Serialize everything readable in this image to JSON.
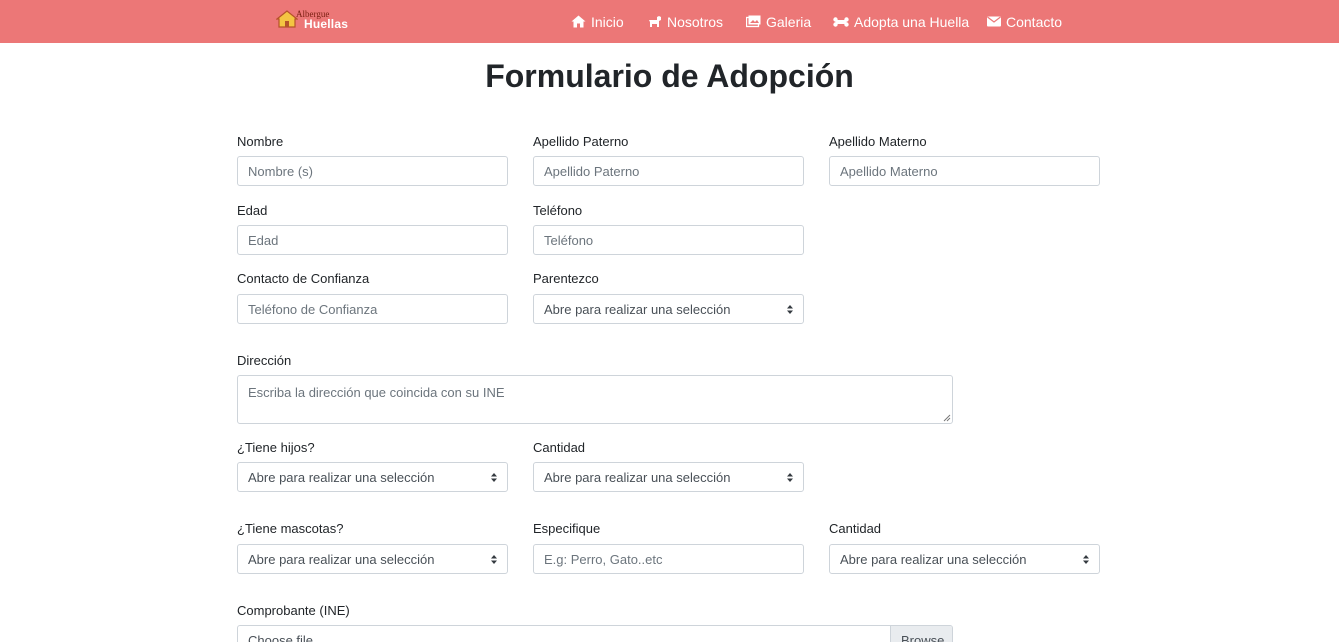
{
  "brand": {
    "line1": "Albergue",
    "line2": "Huellas"
  },
  "nav": {
    "inicio": "Inicio",
    "nosotros": "Nosotros",
    "galeria": "Galeria",
    "adopta": "Adopta una Huella",
    "contacto": "Contacto"
  },
  "colors": {
    "navbar": "#ec7777",
    "text": "#212529",
    "border": "#ced4da"
  },
  "page_title": "Formulario de Adopción",
  "form": {
    "nombre": {
      "label": "Nombre",
      "placeholder": "Nombre (s)"
    },
    "apellido_paterno": {
      "label": "Apellido Paterno",
      "placeholder": "Apellido Paterno"
    },
    "apellido_materno": {
      "label": "Apellido Materno",
      "placeholder": "Apellido Materno"
    },
    "edad": {
      "label": "Edad",
      "placeholder": "Edad"
    },
    "telefono": {
      "label": "Teléfono",
      "placeholder": "Teléfono"
    },
    "contacto_confianza": {
      "label": "Contacto de Confianza",
      "placeholder": "Teléfono de Confianza"
    },
    "parentezco": {
      "label": "Parentezco",
      "selected": "Abre para realizar una selección"
    },
    "direccion": {
      "label": "Dirección",
      "placeholder": "Escriba la dirección que coincida con su INE"
    },
    "tiene_hijos": {
      "label": "¿Tiene hijos?",
      "selected": "Abre para realizar una selección"
    },
    "cantidad_hijos": {
      "label": "Cantidad",
      "selected": "Abre para realizar una selección"
    },
    "tiene_mascotas": {
      "label": "¿Tiene mascotas?",
      "selected": "Abre para realizar una selección"
    },
    "especifique": {
      "label": "Especifique",
      "placeholder": "E.g: Perro, Gato..etc"
    },
    "cantidad_mascotas": {
      "label": "Cantidad",
      "selected": "Abre para realizar una selección"
    },
    "comprobante": {
      "label": "Comprobante (INE)",
      "file_text": "Choose file...",
      "browse": "Browse"
    }
  }
}
